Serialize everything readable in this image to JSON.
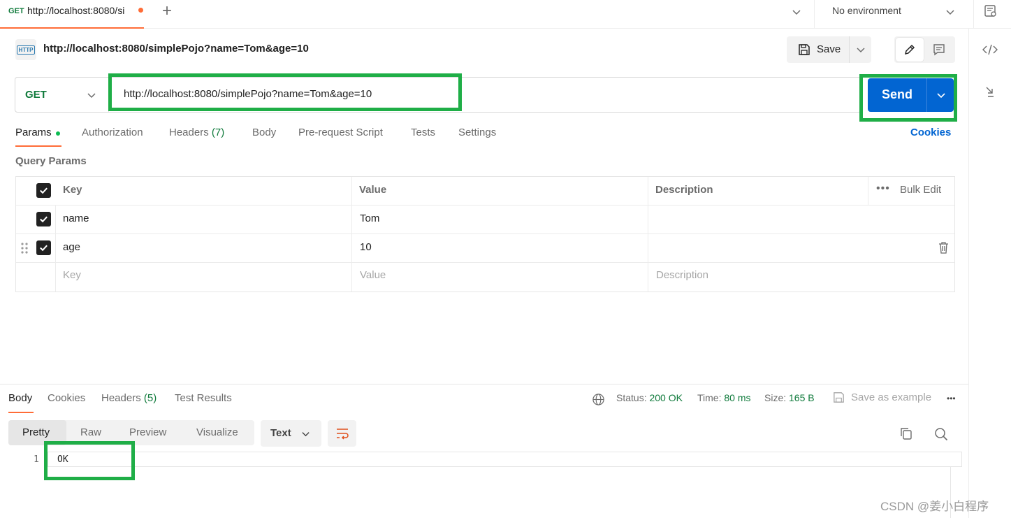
{
  "tab": {
    "method": "GET",
    "url": "http://localhost:8080/si"
  },
  "environment": {
    "selected": "No environment"
  },
  "request": {
    "title": "http://localhost:8080/simplePojo?name=Tom&age=10",
    "method": "GET",
    "url": "http://localhost:8080/simplePojo?name=Tom&age=10",
    "badge": "HTTP"
  },
  "toolbar": {
    "save_label": "Save",
    "send_label": "Send"
  },
  "request_tabs": {
    "params": "Params",
    "authorization": "Authorization",
    "headers": "Headers",
    "headers_count": "(7)",
    "body": "Body",
    "prerequest": "Pre-request Script",
    "tests": "Tests",
    "settings": "Settings",
    "cookies": "Cookies"
  },
  "query_params": {
    "title": "Query Params",
    "columns": {
      "key": "Key",
      "value": "Value",
      "description": "Description",
      "bulk_edit": "Bulk Edit"
    },
    "rows": [
      {
        "key": "name",
        "value": "Tom",
        "description": ""
      },
      {
        "key": "age",
        "value": "10",
        "description": ""
      }
    ],
    "placeholders": {
      "key": "Key",
      "value": "Value",
      "description": "Description"
    }
  },
  "response": {
    "tabs": {
      "body": "Body",
      "cookies": "Cookies",
      "headers": "Headers",
      "headers_count": "(5)",
      "test_results": "Test Results"
    },
    "status_label": "Status:",
    "status_value": "200 OK",
    "time_label": "Time:",
    "time_value": "80 ms",
    "size_label": "Size:",
    "size_value": "165 B",
    "save_example": "Save as example",
    "views": {
      "pretty": "Pretty",
      "raw": "Raw",
      "preview": "Preview",
      "visualize": "Visualize"
    },
    "format": "Text",
    "line_number": "1",
    "body_text": "OK"
  },
  "watermark": "CSDN @姜小白程序",
  "colors": {
    "accent": "#ff6c37",
    "send": "#0265d2",
    "highlight": "#1fae47",
    "get": "#0f7a3b"
  }
}
